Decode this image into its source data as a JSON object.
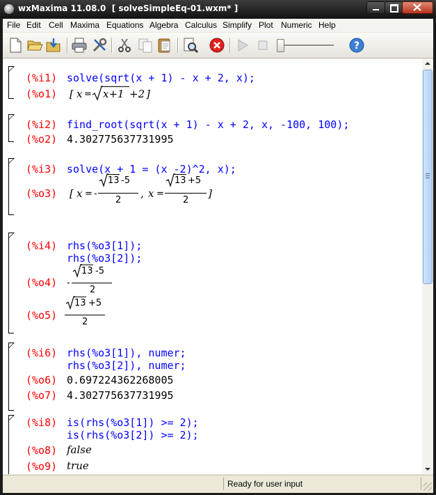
{
  "window": {
    "title": "wxMaxima 11.08.0  [ solveSimpleEq-01.wxm* ]"
  },
  "menu": [
    "File",
    "Edit",
    "Cell",
    "Maxima",
    "Equations",
    "Algebra",
    "Calculus",
    "Simplify",
    "Plot",
    "Numeric",
    "Help"
  ],
  "toolbar": {
    "icons": [
      "new-document-icon",
      "open-folder-icon",
      "save-icon",
      "print-icon",
      "preferences-icon",
      "cut-icon",
      "copy-icon",
      "paste-icon",
      "find-icon",
      "interrupt-icon",
      "play-icon",
      "stop-icon",
      "animation-slider",
      "help-icon"
    ]
  },
  "cells": {
    "c1": {
      "in_label": "(%i1)",
      "input": "solve(sqrt(x + 1) - x + 2, x);",
      "out_label": "(%o1)",
      "out_math": {
        "open": "[",
        "var": "x",
        "eq": "=",
        "radicand": "x+1",
        "tail": "+2",
        "close": "]"
      }
    },
    "c2": {
      "in_label": "(%i2)",
      "input": "find_root(sqrt(x + 1) - x + 2, x, -100, 100);",
      "out_label": "(%o2)",
      "output": "4.302775637731995"
    },
    "c3": {
      "in_label": "(%i3)",
      "input": "solve(x + 1 = (x -2)^2, x);",
      "out_label": "(%o3)",
      "out_math": {
        "open": "[",
        "var1": "x",
        "eq": "=",
        "neg": "-",
        "rad1": "13",
        "num1_tail": "-5",
        "den1": "2",
        "comma": ",",
        "var2": "x",
        "rad2": "13",
        "num2_tail": "+5",
        "den2": "2",
        "close": "]"
      }
    },
    "c4": {
      "in_label": "(%i4)",
      "input1": "rhs(%o3[1]);",
      "input2": "rhs(%o3[2]);",
      "out4_label": "(%o4)",
      "out4": {
        "neg": "-",
        "rad": "13",
        "tail": "-5",
        "den": "2"
      },
      "out5_label": "(%o5)",
      "out5": {
        "rad": "13",
        "tail": "+5",
        "den": "2"
      }
    },
    "c5": {
      "in_label": "(%i6)",
      "input1": "rhs(%o3[1]), numer;",
      "input2": "rhs(%o3[2]), numer;",
      "out6_label": "(%o6)",
      "output6": "0.697224362268005",
      "out7_label": "(%o7)",
      "output7": "4.302775637731995"
    },
    "c6": {
      "in_label": "(%i8)",
      "input1": "is(rhs(%o3[1]) >= 2);",
      "input2": "is(rhs(%o3[2]) >= 2);",
      "out8_label": "(%o8)",
      "output8": "false",
      "out9_label": "(%o9)",
      "output9": "true"
    }
  },
  "status": {
    "text": "Ready for user input"
  },
  "colors": {
    "input_label": "#ff0000",
    "input_text": "#0000ff",
    "output_text": "#000000",
    "titlebar": "#1b1b1b",
    "close_button": "#c8432a"
  }
}
